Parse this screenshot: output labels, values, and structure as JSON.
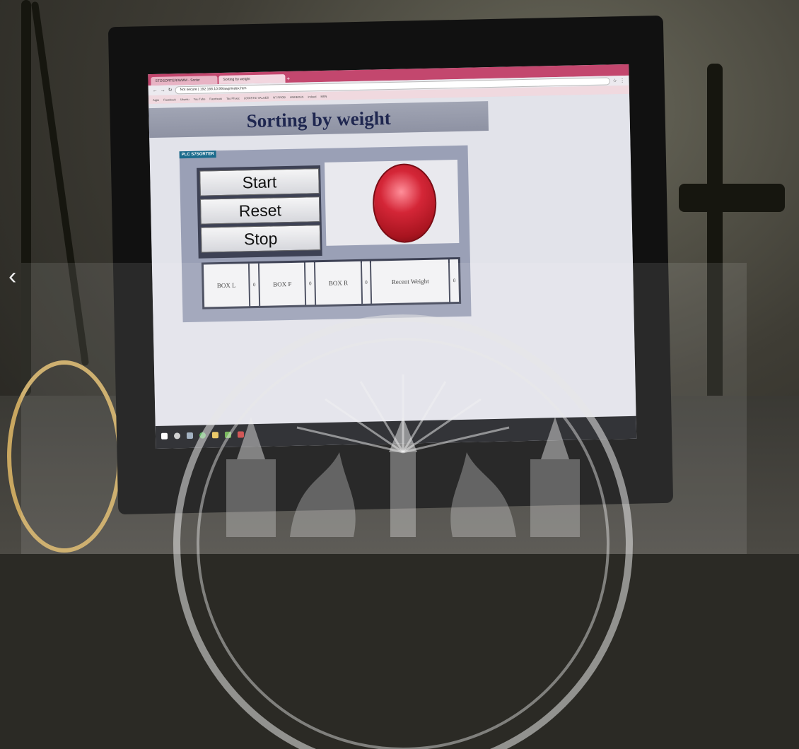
{
  "browser": {
    "tabs": [
      {
        "label": "STOSORTER/WMM - Sorter"
      },
      {
        "label": "Sorting by weight"
      }
    ],
    "new_tab_icon": "plus-icon",
    "address": "Not secure | 192.168.10.99/awp/index.htm",
    "bookmarks": [
      "Apps",
      "Facebook",
      "Ubuntu",
      "You Tube",
      "Facebook",
      "Tao Phuoc",
      "LOGISTIC VALUES",
      "NT PROB",
      "LINKEDLN",
      "indeed",
      "MSN"
    ]
  },
  "page": {
    "title": "Sorting by weight",
    "panel_label": "PLC S7SORTER",
    "buttons": {
      "start": "Start",
      "reset": "Reset",
      "stop": "Stop"
    },
    "lamp": {
      "state": "off",
      "color": "#d42637"
    },
    "boxes": [
      {
        "label": "BOX L",
        "value": "0"
      },
      {
        "label": "BOX F",
        "value": "0"
      },
      {
        "label": "BOX R",
        "value": "0"
      },
      {
        "label": "Recent Weight",
        "value": "0"
      }
    ]
  },
  "overlay": {
    "nav_arrow": "‹",
    "watermark": "university-seal"
  }
}
